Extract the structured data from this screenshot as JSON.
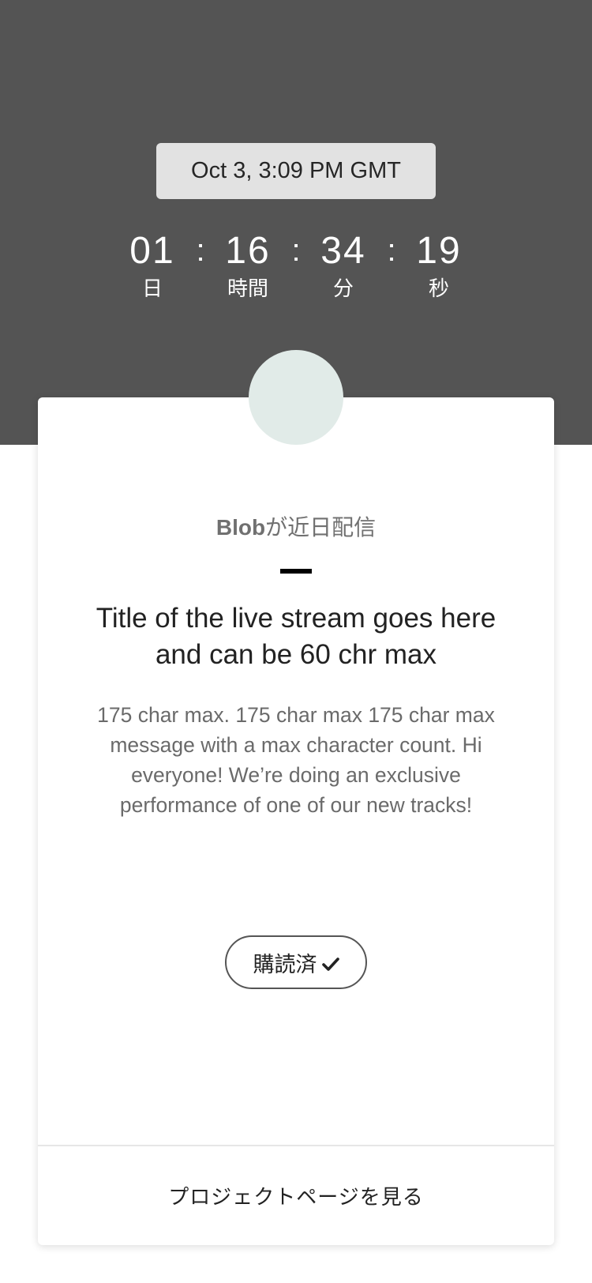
{
  "event": {
    "date_time": "Oct 3, 3:09 PM GMT"
  },
  "countdown": {
    "days": {
      "value": "01",
      "label": "日"
    },
    "hours": {
      "value": "16",
      "label": "時間"
    },
    "minutes": {
      "value": "34",
      "label": "分"
    },
    "seconds": {
      "value": "19",
      "label": "秒"
    },
    "separator": ":"
  },
  "card": {
    "artist": "Blob",
    "coming_soon_suffix": "が近日配信",
    "title": "Title of the live stream goes here and can be 60 chr max",
    "description": "175 char max. 175 char max 175 char max message with a max character count. Hi everyone! We’re doing an exclusive performance of one of our new tracks!",
    "subscribed_label": "購読済",
    "subscribed_icon": "checkmark-icon",
    "project_link_label": "プロジェクトページを見る"
  },
  "colors": {
    "hero_background": "#545454",
    "avatar_placeholder": "#e1ebe8",
    "date_pill": "#e2e2e2"
  }
}
